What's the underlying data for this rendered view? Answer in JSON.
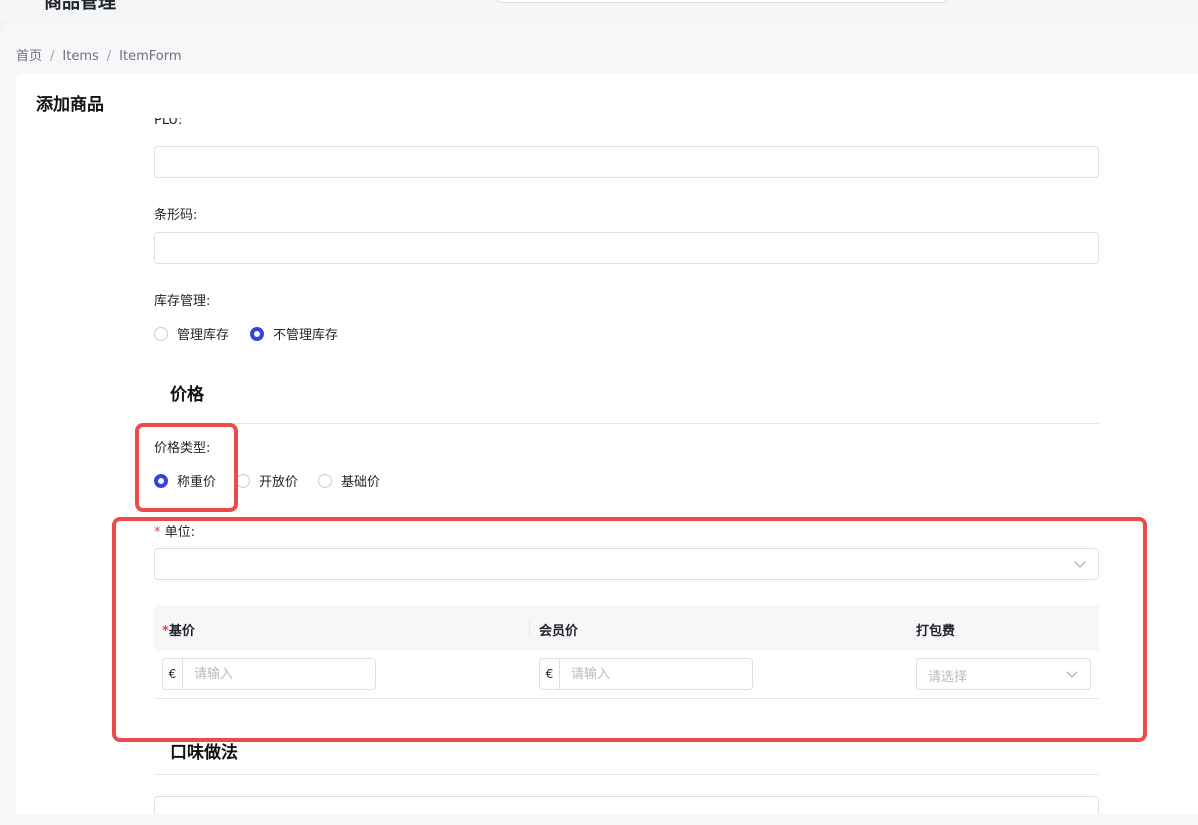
{
  "app": {
    "title": "商品管理"
  },
  "breadcrumb": {
    "items": [
      "首页",
      "Items",
      "ItemForm"
    ],
    "separator": "/"
  },
  "card": {
    "title": "添加商品"
  },
  "fields": {
    "plu": {
      "label": "PLU:"
    },
    "barcode": {
      "label": "条形码:"
    },
    "inventory": {
      "label": "库存管理:",
      "options": [
        "管理库存",
        "不管理库存"
      ],
      "selected": "不管理库存"
    }
  },
  "price": {
    "section_title": "价格",
    "price_type": {
      "label": "价格类型:",
      "options": [
        "称重价",
        "开放价",
        "基础价"
      ],
      "selected": "称重价"
    },
    "unit": {
      "required_mark": "*",
      "label": "单位:"
    },
    "table": {
      "headers": {
        "base": "基价",
        "member": "会员价",
        "packing": "打包费"
      },
      "required_mark": "*",
      "currency_symbol": "€",
      "input_placeholder": "请输入",
      "select_placeholder": "请选择"
    }
  },
  "flavor": {
    "section_title": "口味做法"
  },
  "colors": {
    "accent": "#3b40e0",
    "annotation": "#ec4b4b",
    "required": "#f03c3c"
  }
}
